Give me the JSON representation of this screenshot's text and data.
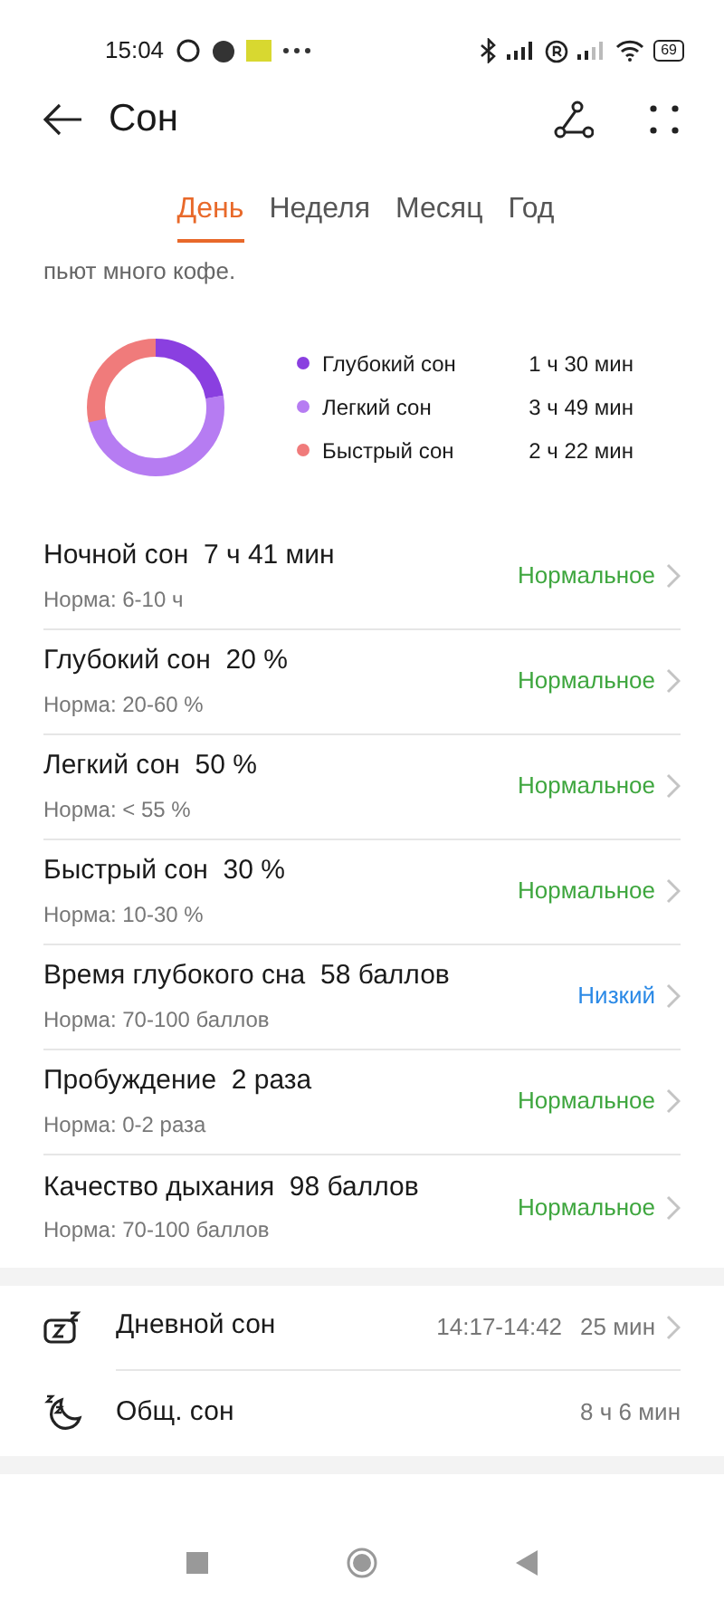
{
  "status_bar": {
    "time": "15:04",
    "battery": "69"
  },
  "header": {
    "title": "Сон"
  },
  "tabs": [
    {
      "label": "День",
      "selected": true
    },
    {
      "label": "Неделя",
      "selected": false
    },
    {
      "label": "Месяц",
      "selected": false
    },
    {
      "label": "Год",
      "selected": false
    }
  ],
  "intro_text": "пьют много кофе.",
  "legend": [
    {
      "label": "Глубокий сон",
      "value": "1 ч 30 мин",
      "color": "#8a3fe0"
    },
    {
      "label": "Легкий сон",
      "value": "3 ч 49 мин",
      "color": "#b67cf2"
    },
    {
      "label": "Быстрый сон",
      "value": "2 ч 22 мин",
      "color": "#f07b7b"
    }
  ],
  "metrics": [
    {
      "title": "Ночной сон  7 ч 41 мин",
      "norm": "Норма: 6-10 ч",
      "status": "Нормальное",
      "kind": "normal"
    },
    {
      "title": "Глубокий сон  20 %",
      "norm": "Норма: 20-60 %",
      "status": "Нормальное",
      "kind": "normal"
    },
    {
      "title": "Легкий сон  50 %",
      "norm": "Норма: < 55 %",
      "status": "Нормальное",
      "kind": "normal"
    },
    {
      "title": "Быстрый сон  30 %",
      "norm": "Норма: 10-30 %",
      "status": "Нормальное",
      "kind": "normal"
    },
    {
      "title": "Время глубокого сна  58 баллов",
      "norm": "Норма: 70-100 баллов",
      "status": "Низкий",
      "kind": "low"
    },
    {
      "title": "Пробуждение  2 раза",
      "norm": "Норма: 0-2 раза",
      "status": "Нормальное",
      "kind": "normal"
    },
    {
      "title": "Качество дыхания  98 баллов",
      "norm": "Норма: 70-100 баллов",
      "status": "Нормальное",
      "kind": "normal"
    }
  ],
  "summary": [
    {
      "kind": "nap",
      "label": "Дневной сон",
      "time": "14:17-14:42",
      "value": "25 мин",
      "chevron": true
    },
    {
      "kind": "total",
      "label": "Общ. сон",
      "value": "8 ч 6 мин",
      "chevron": false
    }
  ]
}
